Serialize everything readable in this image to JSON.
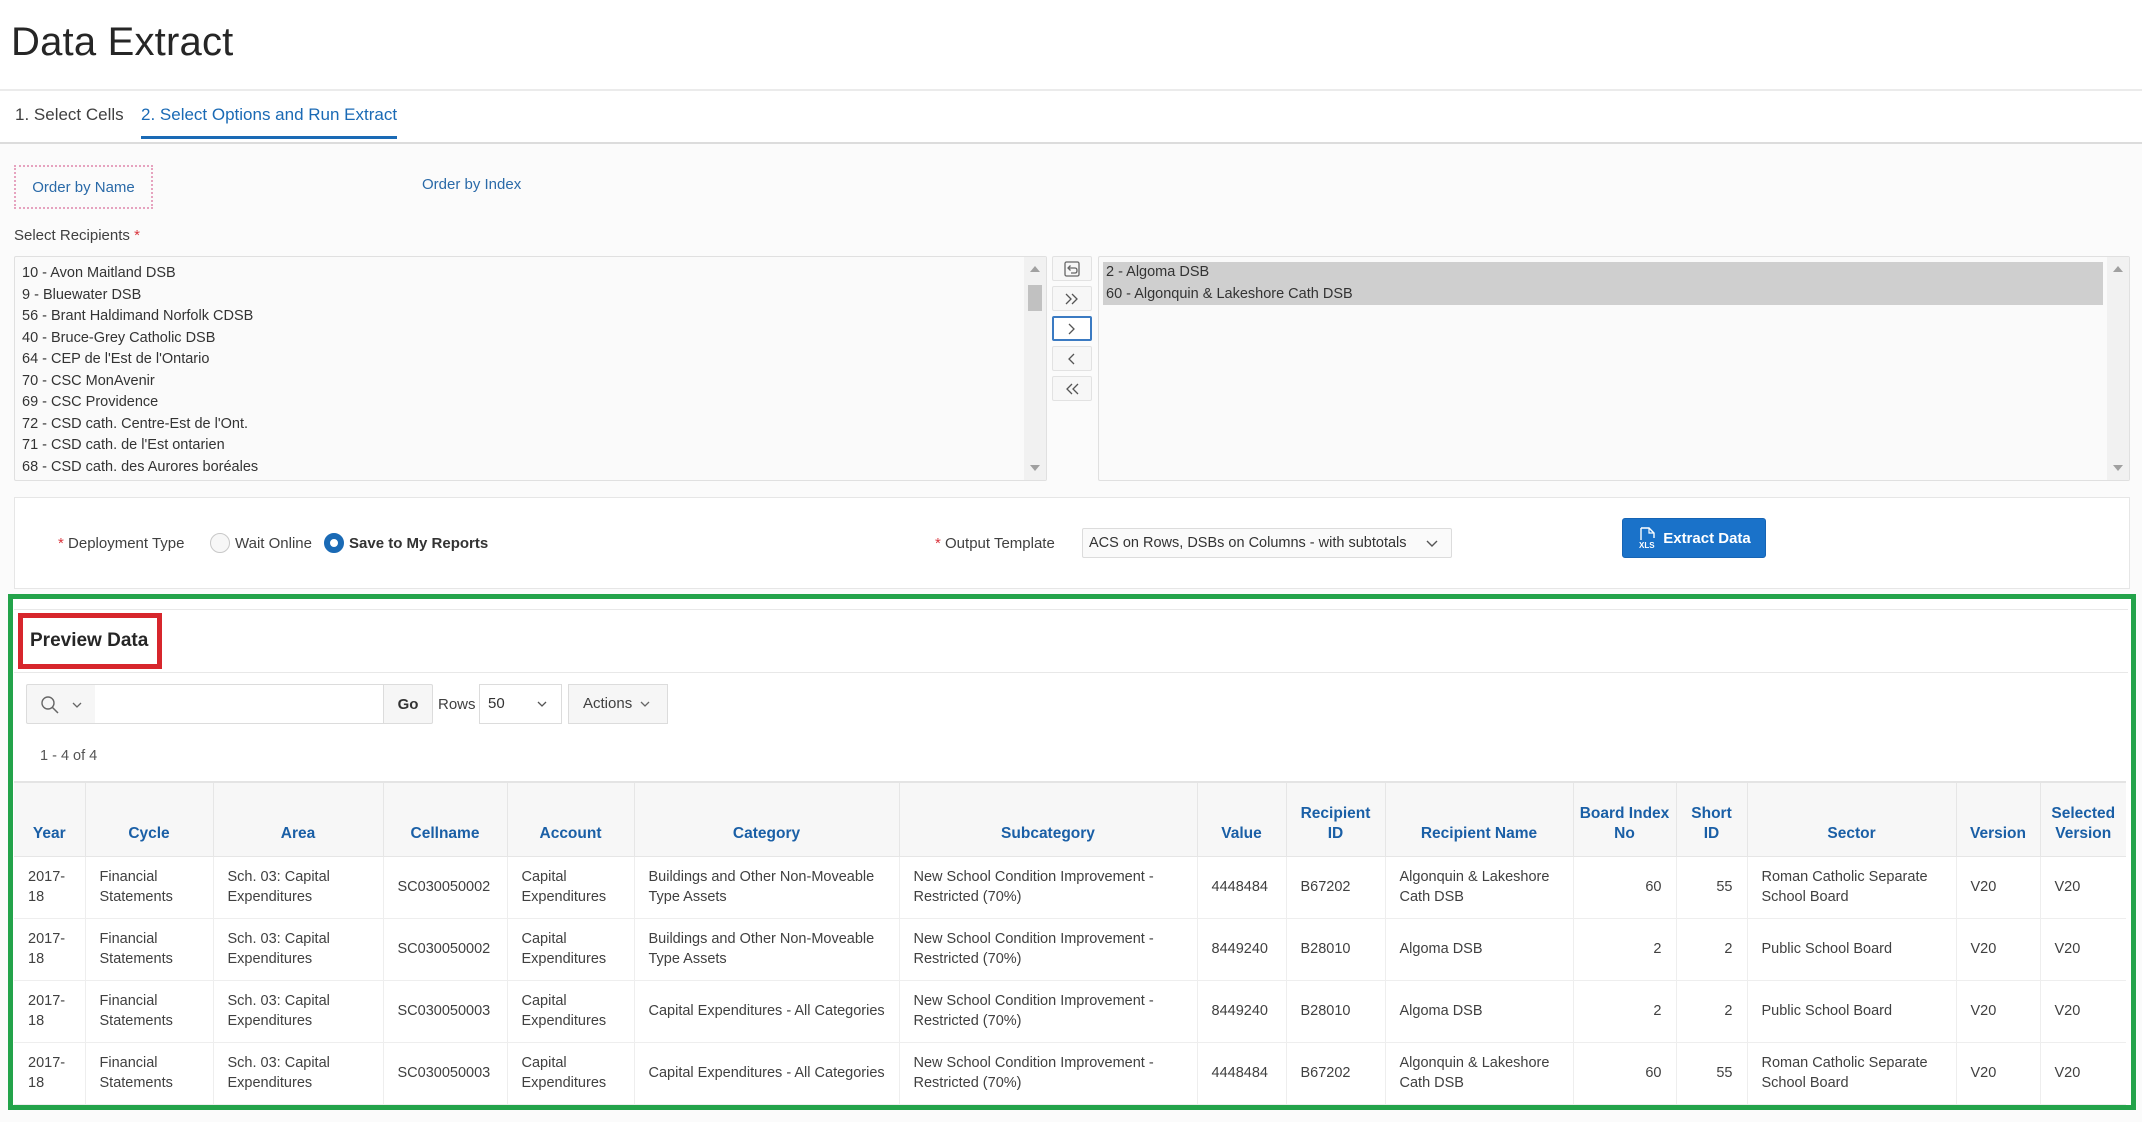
{
  "page": {
    "title": "Data Extract"
  },
  "tabs": [
    {
      "label": "1. Select Cells",
      "active": false
    },
    {
      "label": "2. Select Options and Run Extract",
      "active": true
    }
  ],
  "order": {
    "by_name": "Order by Name",
    "by_index": "Order by Index"
  },
  "recipients": {
    "label": "Select Recipients",
    "required_mark": "*",
    "available": [
      "10 - Avon Maitland DSB",
      "9 - Bluewater DSB",
      "56 - Brant Haldimand Norfolk CDSB",
      "40 - Bruce-Grey Catholic DSB",
      "64 - CEP de l'Est de l'Ontario",
      "70 - CSC MonAvenir",
      "69 - CSC Providence",
      "72 - CSD cath. Centre-Est de l'Ont.",
      "71 - CSD cath. de l'Est ontarien",
      "68 - CSD cath. des Aurores boréales"
    ],
    "selected": [
      "2 - Algoma DSB",
      "60 - Algonquin & Lakeshore Cath DSB"
    ],
    "shuttle_buttons": [
      {
        "name": "reset",
        "icon": "undo-icon"
      },
      {
        "name": "move-all",
        "icon": "double-chevron-right-icon"
      },
      {
        "name": "move",
        "icon": "chevron-right-icon"
      },
      {
        "name": "remove",
        "icon": "chevron-left-icon"
      },
      {
        "name": "remove-all",
        "icon": "double-chevron-left-icon"
      }
    ]
  },
  "options": {
    "deployment_label": "Deployment Type",
    "required_mark": "*",
    "deployment_options": [
      {
        "label": "Wait Online",
        "checked": false
      },
      {
        "label": "Save to My Reports",
        "checked": true
      }
    ],
    "template_label": "Output Template",
    "template_value": "ACS on Rows, DSBs on Columns - with subtotals",
    "extract_button": "Extract Data",
    "extract_icon": "xls-file-icon"
  },
  "preview": {
    "title": "Preview Data",
    "search_placeholder": "",
    "search_value": "",
    "go_label": "Go",
    "rows_label": "Rows",
    "rows_value": "50",
    "actions_label": "Actions",
    "count": "1 - 4 of 4",
    "colors": {
      "highlight_frame": "#23a34a",
      "title_highlight": "#d7262c",
      "header_text": "#1a5fa6",
      "primary_button": "#1a72c9"
    },
    "columns": [
      "Year",
      "Cycle",
      "Area",
      "Cellname",
      "Account",
      "Category",
      "Subcategory",
      "Value",
      "Recipient ID",
      "Recipient Name",
      "Board Index No",
      "Short ID",
      "Sector",
      "Version",
      "Selected Version"
    ],
    "rows": [
      [
        "2017-18",
        "Financial Statements",
        "Sch. 03: Capital Expenditures",
        "SC030050002",
        "Capital Expenditures",
        "Buildings and Other Non-Moveable Type Assets",
        "New School Condition Improvement - Restricted (70%)",
        "4448484",
        "B67202",
        "Algonquin & Lakeshore Cath DSB",
        "60",
        "55",
        "Roman Catholic Separate School Board",
        "V20",
        "V20"
      ],
      [
        "2017-18",
        "Financial Statements",
        "Sch. 03: Capital Expenditures",
        "SC030050002",
        "Capital Expenditures",
        "Buildings and Other Non-Moveable Type Assets",
        "New School Condition Improvement - Restricted (70%)",
        "8449240",
        "B28010",
        "Algoma DSB",
        "2",
        "2",
        "Public School Board",
        "V20",
        "V20"
      ],
      [
        "2017-18",
        "Financial Statements",
        "Sch. 03: Capital Expenditures",
        "SC030050003",
        "Capital Expenditures",
        "Capital Expenditures - All Categories",
        "New School Condition Improvement - Restricted (70%)",
        "8449240",
        "B28010",
        "Algoma DSB",
        "2",
        "2",
        "Public School Board",
        "V20",
        "V20"
      ],
      [
        "2017-18",
        "Financial Statements",
        "Sch. 03: Capital Expenditures",
        "SC030050003",
        "Capital Expenditures",
        "Capital Expenditures - All Categories",
        "New School Condition Improvement - Restricted (70%)",
        "4448484",
        "B67202",
        "Algonquin & Lakeshore Cath DSB",
        "60",
        "55",
        "Roman Catholic Separate School Board",
        "V20",
        "V20"
      ]
    ]
  }
}
